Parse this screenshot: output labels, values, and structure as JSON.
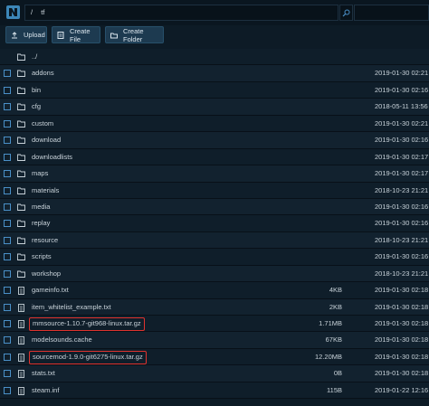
{
  "header": {
    "path_root": "/",
    "path_dir": "tf"
  },
  "toolbar": {
    "upload_label": "Upload",
    "create_file_label": "Create File",
    "create_folder_label": "Create Folder"
  },
  "files": [
    {
      "name": "../",
      "type": "folder",
      "size": "",
      "date": "",
      "highlighted": false,
      "checkbox": false
    },
    {
      "name": "addons",
      "type": "folder",
      "size": "",
      "date": "2019-01-30 02:21",
      "highlighted": false,
      "checkbox": true
    },
    {
      "name": "bin",
      "type": "folder",
      "size": "",
      "date": "2019-01-30 02:16",
      "highlighted": false,
      "checkbox": true
    },
    {
      "name": "cfg",
      "type": "folder",
      "size": "",
      "date": "2018-05-11 13:56",
      "highlighted": false,
      "checkbox": true
    },
    {
      "name": "custom",
      "type": "folder",
      "size": "",
      "date": "2019-01-30 02:21",
      "highlighted": false,
      "checkbox": true
    },
    {
      "name": "download",
      "type": "folder",
      "size": "",
      "date": "2019-01-30 02:16",
      "highlighted": false,
      "checkbox": true
    },
    {
      "name": "downloadlists",
      "type": "folder",
      "size": "",
      "date": "2019-01-30 02:17",
      "highlighted": false,
      "checkbox": true
    },
    {
      "name": "maps",
      "type": "folder",
      "size": "",
      "date": "2019-01-30 02:17",
      "highlighted": false,
      "checkbox": true
    },
    {
      "name": "materials",
      "type": "folder",
      "size": "",
      "date": "2018-10-23 21:21",
      "highlighted": false,
      "checkbox": true
    },
    {
      "name": "media",
      "type": "folder",
      "size": "",
      "date": "2019-01-30 02:16",
      "highlighted": false,
      "checkbox": true
    },
    {
      "name": "replay",
      "type": "folder",
      "size": "",
      "date": "2019-01-30 02:16",
      "highlighted": false,
      "checkbox": true
    },
    {
      "name": "resource",
      "type": "folder",
      "size": "",
      "date": "2018-10-23 21:21",
      "highlighted": false,
      "checkbox": true
    },
    {
      "name": "scripts",
      "type": "folder",
      "size": "",
      "date": "2019-01-30 02:16",
      "highlighted": false,
      "checkbox": true
    },
    {
      "name": "workshop",
      "type": "folder",
      "size": "",
      "date": "2018-10-23 21:21",
      "highlighted": false,
      "checkbox": true
    },
    {
      "name": "gameinfo.txt",
      "type": "file",
      "size": "4KB",
      "date": "2019-01-30 02:18",
      "highlighted": false,
      "checkbox": true
    },
    {
      "name": "item_whitelist_example.txt",
      "type": "file",
      "size": "2KB",
      "date": "2019-01-30 02:18",
      "highlighted": false,
      "checkbox": true
    },
    {
      "name": "mmsource-1.10.7-git968-linux.tar.gz",
      "type": "file",
      "size": "1.71MB",
      "date": "2019-01-30 02:18",
      "highlighted": true,
      "checkbox": true
    },
    {
      "name": "modelsounds.cache",
      "type": "file",
      "size": "67KB",
      "date": "2019-01-30 02:18",
      "highlighted": false,
      "checkbox": true
    },
    {
      "name": "sourcemod-1.9.0-git6275-linux.tar.gz",
      "type": "file",
      "size": "12.20MB",
      "date": "2019-01-30 02:18",
      "highlighted": true,
      "checkbox": true
    },
    {
      "name": "stats.txt",
      "type": "file",
      "size": "0B",
      "date": "2019-01-30 02:18",
      "highlighted": false,
      "checkbox": true
    },
    {
      "name": "steam.inf",
      "type": "file",
      "size": "115B",
      "date": "2019-01-22 12:16",
      "highlighted": false,
      "checkbox": true
    }
  ],
  "colors": {
    "accent": "#4a90c8",
    "highlight": "#e0332f",
    "background": "#0d1b26"
  },
  "icons": {
    "logo": "file-manager-logo-icon",
    "search": "search-icon",
    "folder": "folder-icon",
    "file": "file-icon",
    "upload": "upload-icon",
    "create_file": "create-file-icon",
    "create_folder": "create-folder-icon"
  }
}
